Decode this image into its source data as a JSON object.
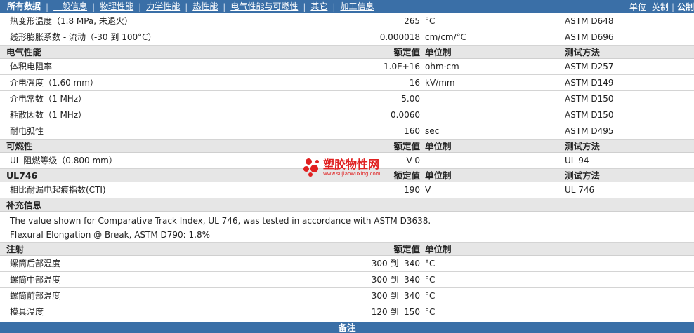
{
  "nav": {
    "items": [
      "所有数据",
      "一般信息",
      "物理性能",
      "力学性能",
      "热性能",
      "电气性能与可燃性",
      "其它",
      "加工信息"
    ],
    "separator": "|",
    "unit_label": "单位",
    "unit_imperial": "英制",
    "unit_sep": "|",
    "unit_metric": "公制"
  },
  "thermal_rows": [
    {
      "name": "热变形温度（1.8 MPa, 未退火）",
      "value": "265",
      "unit": "°C",
      "method": "ASTM D648"
    },
    {
      "name": "线形膨胀系数 - 流动（-30 到 100°C）",
      "value": "0.000018",
      "unit": "cm/cm/°C",
      "method": "ASTM D696"
    }
  ],
  "electrical": {
    "title": "电气性能",
    "col_value": "额定值",
    "col_unit": "单位制",
    "col_method": "测试方法",
    "rows": [
      {
        "name": "体积电阻率",
        "value": "1.0E+16",
        "unit": "ohm·cm",
        "method": "ASTM D257"
      },
      {
        "name": "介电强度（1.60 mm）",
        "value": "16",
        "unit": "kV/mm",
        "method": "ASTM D149"
      },
      {
        "name": "介电常数（1 MHz）",
        "value": "5.00",
        "unit": "",
        "method": "ASTM D150"
      },
      {
        "name": "耗散因数（1 MHz）",
        "value": "0.0060",
        "unit": "",
        "method": "ASTM D150"
      },
      {
        "name": "耐电弧性",
        "value": "160",
        "unit": "sec",
        "method": "ASTM D495"
      }
    ]
  },
  "flammability": {
    "title": "可燃性",
    "col_value": "额定值",
    "col_unit": "单位制",
    "col_method": "测试方法",
    "rows": [
      {
        "name": "UL 阻燃等级（0.800 mm）",
        "value": "V-0",
        "unit": "",
        "method": "UL 94"
      }
    ]
  },
  "ul746": {
    "title": "UL746",
    "col_value": "额定值",
    "col_unit": "单位制",
    "col_method": "测试方法",
    "rows": [
      {
        "name": "相比耐漏电起痕指数(CTI)",
        "value": "190",
        "unit": "V",
        "method": "UL 746"
      }
    ]
  },
  "supplement": {
    "title": "补充信息",
    "notes": [
      "The value shown for Comparative Track Index, UL 746, was tested in accordance with ASTM D3638.",
      "Flexural Elongation @ Break, ASTM D790: 1.8%"
    ]
  },
  "injection": {
    "title": "注射",
    "col_value": "额定值",
    "col_unit": "单位制",
    "rows": [
      {
        "name": "螺筒后部温度",
        "value": "300 到  340",
        "unit": "°C"
      },
      {
        "name": "螺筒中部温度",
        "value": "300 到  340",
        "unit": "°C"
      },
      {
        "name": "螺筒前部温度",
        "value": "300 到  340",
        "unit": "°C"
      },
      {
        "name": "模具温度",
        "value": "120 到  150",
        "unit": "°C"
      }
    ]
  },
  "footer": {
    "label": "备注"
  },
  "watermark": {
    "text": "塑胶物性网",
    "url": "www.sujiaowuxing.com",
    "color": "#e02020"
  },
  "colors": {
    "bar": "#3a6fa7",
    "header_bg": "#e6e6e6"
  }
}
